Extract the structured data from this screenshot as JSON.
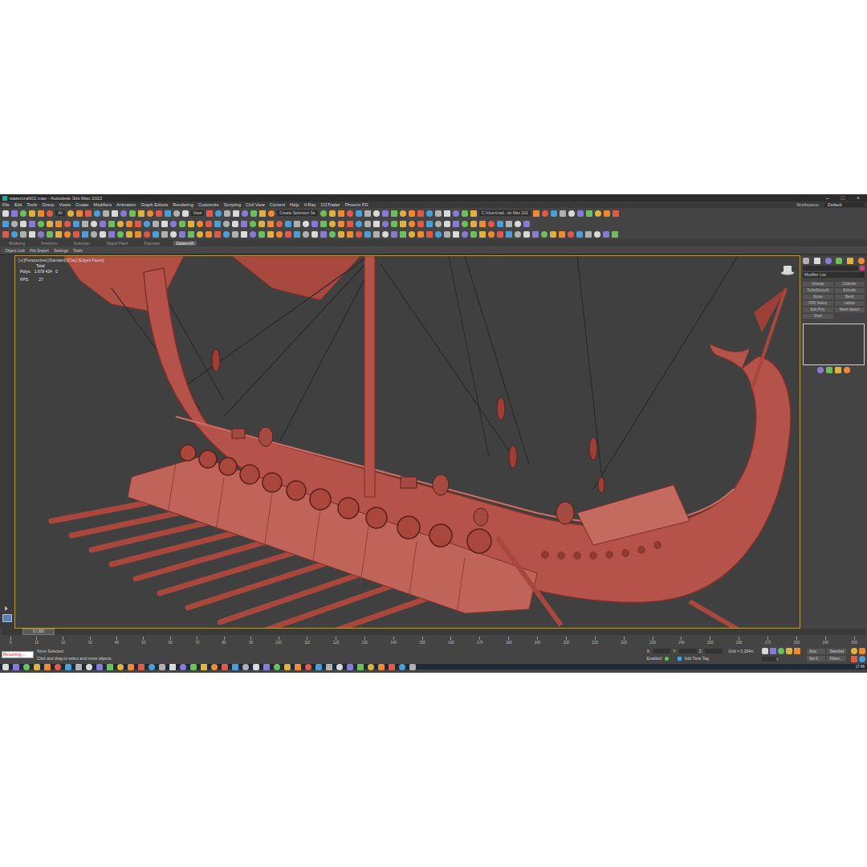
{
  "window": {
    "title": "watercraft02.max - Autodesk 3ds Max 2022",
    "controls": [
      "–",
      "□",
      "×"
    ]
  },
  "menu": [
    "File",
    "Edit",
    "Tools",
    "Group",
    "Views",
    "Create",
    "Modifiers",
    "Animation",
    "Graph Editors",
    "Rendering",
    "Customize",
    "Scripting",
    "Civil View",
    "Content",
    "Help",
    "V-Ray",
    "CGTrader",
    "Phoenix FD"
  ],
  "workspace": {
    "label": "Workspace:",
    "value": "Default"
  },
  "toolbar": {
    "filter": "All",
    "coord": "View",
    "selection_set": "Create Selection Se",
    "project": "C:\\Users\\rad...ds Max 202"
  },
  "ribbon_tabs": [
    {
      "label": "Modeling",
      "selected": false
    },
    {
      "label": "Freeform",
      "selected": false
    },
    {
      "label": "Selection",
      "selected": false
    },
    {
      "label": "Object Paint",
      "selected": false
    },
    {
      "label": "Populate",
      "selected": false
    },
    {
      "label": "Datasmith",
      "selected": true
    }
  ],
  "ribbon_items": [
    "Object Link",
    "File Export",
    "Settings",
    "Tools"
  ],
  "viewport": {
    "labels": [
      "[+]",
      "[Perspective]",
      "[Standard]",
      "[Clay]",
      "[Edged Faces]"
    ],
    "total": "Total",
    "polys_label": "Polys:",
    "polys": "1 679 434",
    "polys_selected": "0",
    "fps_label": "FPS:",
    "fps": "27"
  },
  "command_panel": {
    "modifier_list": "Modifier List",
    "buttons": [
      "Unwrap",
      "Chamfer",
      "TurboSmooth",
      "Extrude",
      "Noise",
      "Bend",
      "FFD Select",
      "Lattice",
      "Edit Poly",
      "Mesh Select",
      "Shell"
    ]
  },
  "timeline": {
    "slider": "0 / 300",
    "level": 0,
    "ticks": [
      "0",
      "10",
      "20",
      "30",
      "40",
      "50",
      "60",
      "70",
      "80",
      "90",
      "100",
      "110",
      "120",
      "130",
      "140",
      "150",
      "160",
      "170",
      "180",
      "190",
      "200",
      "210",
      "220",
      "230",
      "240",
      "250",
      "260",
      "270",
      "280",
      "290",
      "300"
    ]
  },
  "status": {
    "listener": "Resuming ...",
    "selection": "None Selected",
    "prompt": "Click and drag to select and move objects",
    "coords": [
      "X:",
      "Y:",
      "Z:"
    ],
    "grid": "Grid = 0,254m",
    "enabled": "Enabled:",
    "time_tag": "Add Time Tag",
    "keys": [
      "Auto",
      "Selected",
      "Set K.",
      "Filters..."
    ],
    "frame": "0"
  },
  "taskbar": {
    "time": "17:46"
  }
}
